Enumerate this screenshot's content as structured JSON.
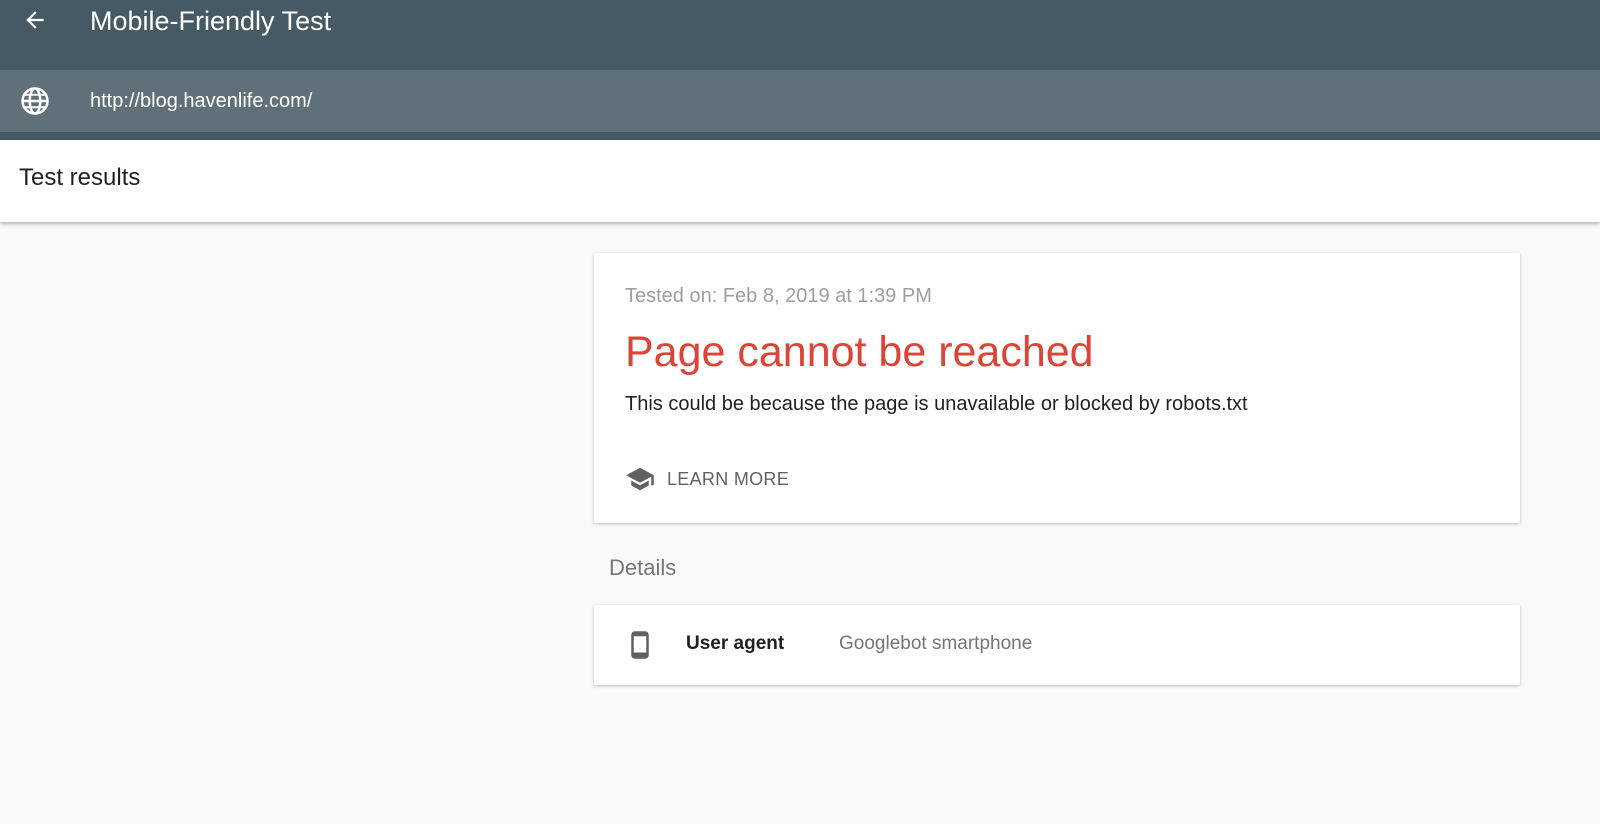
{
  "header": {
    "title": "Mobile-Friendly Test",
    "back_icon": "arrow-back-icon"
  },
  "url_bar": {
    "icon": "globe-icon",
    "value": "http://blog.havenlife.com/"
  },
  "results_header": {
    "title": "Test results"
  },
  "result_card": {
    "tested_on": "Tested on: Feb 8, 2019 at 1:39 PM",
    "status_title": "Page cannot be reached",
    "status_color": "#db4437",
    "description": "This could be because the page is unavailable or blocked by robots.txt",
    "learn_more": {
      "label": "LEARN MORE",
      "icon": "graduation-cap-icon"
    }
  },
  "details": {
    "heading": "Details",
    "rows": [
      {
        "icon": "smartphone-icon",
        "label": "User agent",
        "value": "Googlebot smartphone"
      }
    ]
  },
  "colors": {
    "topbar": "#455a64",
    "urlbar": "#5f7079",
    "background": "#f9f9f9",
    "error": "#db4437"
  }
}
